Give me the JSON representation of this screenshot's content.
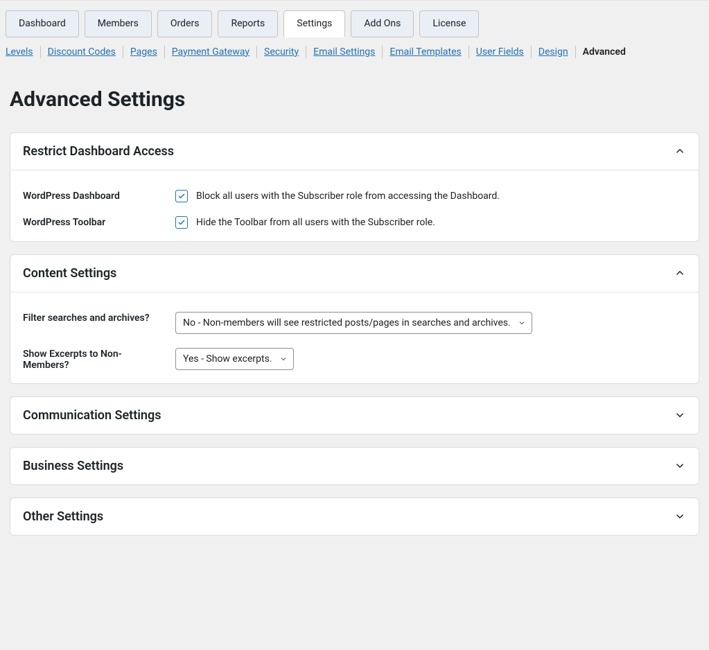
{
  "tabs": [
    {
      "label": "Dashboard"
    },
    {
      "label": "Members"
    },
    {
      "label": "Orders"
    },
    {
      "label": "Reports"
    },
    {
      "label": "Settings",
      "active": true
    },
    {
      "label": "Add Ons"
    },
    {
      "label": "License"
    }
  ],
  "subtabs": [
    {
      "label": "Levels"
    },
    {
      "label": "Discount Codes"
    },
    {
      "label": "Pages"
    },
    {
      "label": "Payment Gateway"
    },
    {
      "label": "Security"
    },
    {
      "label": "Email Settings"
    },
    {
      "label": "Email Templates"
    },
    {
      "label": "User Fields"
    },
    {
      "label": "Design"
    },
    {
      "label": "Advanced",
      "current": true
    }
  ],
  "page_title": "Advanced Settings",
  "panels": {
    "restrict": {
      "title": "Restrict Dashboard Access",
      "wp_dashboard_label": "WordPress Dashboard",
      "wp_dashboard_desc": "Block all users with the Subscriber role from accessing the Dashboard.",
      "wp_toolbar_label": "WordPress Toolbar",
      "wp_toolbar_desc": "Hide the Toolbar from all users with the Subscriber role."
    },
    "content": {
      "title": "Content Settings",
      "filter_label": "Filter searches and archives?",
      "filter_value": "No - Non-members will see restricted posts/pages in searches and archives.",
      "excerpts_label": "Show Excerpts to Non-Members?",
      "excerpts_value": "Yes - Show excerpts."
    },
    "communication": {
      "title": "Communication Settings"
    },
    "business": {
      "title": "Business Settings"
    },
    "other": {
      "title": "Other Settings"
    }
  }
}
